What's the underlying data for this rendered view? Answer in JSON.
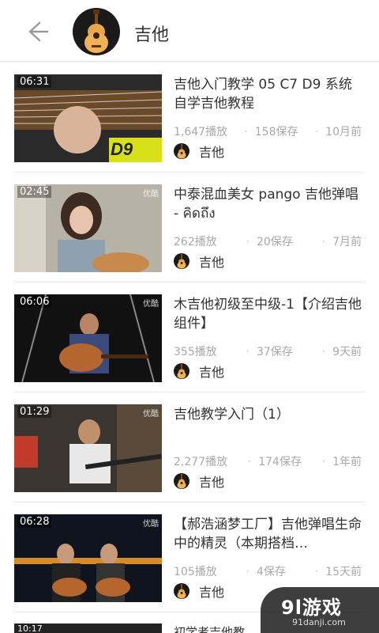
{
  "header": {
    "title": "吉他",
    "back_icon": "arrow-left-icon",
    "avatar_icon": "guitar-icon"
  },
  "videos": [
    {
      "duration": "06:31",
      "title": "吉他入门教学 05 C7 D9 系统自学吉他教程",
      "plays": "1,647播放",
      "saves": "158保存",
      "time": "10月前",
      "owner": "吉他",
      "thumb_text": "D9"
    },
    {
      "duration": "02:45",
      "title": "中泰混血美女 pango 吉他弹唱 - คิดถึง",
      "plays": "262播放",
      "saves": "20保存",
      "time": "7月前",
      "owner": "吉他",
      "badge": "优酷"
    },
    {
      "duration": "06:06",
      "title": "木吉他初级至中级-1【介绍吉他组件】",
      "plays": "355播放",
      "saves": "37保存",
      "time": "9天前",
      "owner": "吉他",
      "badge": "优酷"
    },
    {
      "duration": "01:29",
      "title": "吉他教学入门（1）",
      "plays": "2,277播放",
      "saves": "174保存",
      "time": "1年前",
      "owner": "吉他",
      "badge": "优酷"
    },
    {
      "duration": "06:28",
      "title": "【郝浩涵梦工厂】吉他弹唱生命中的精灵（本期搭档…",
      "plays": "105播放",
      "saves": "4保存",
      "time": "15天前",
      "owner": "吉他",
      "badge": "优酷"
    }
  ],
  "partial": {
    "duration": "10:17",
    "title": "初学者吉他教"
  },
  "watermark": {
    "line1": "9l游戏",
    "line2": "91danji.com"
  }
}
